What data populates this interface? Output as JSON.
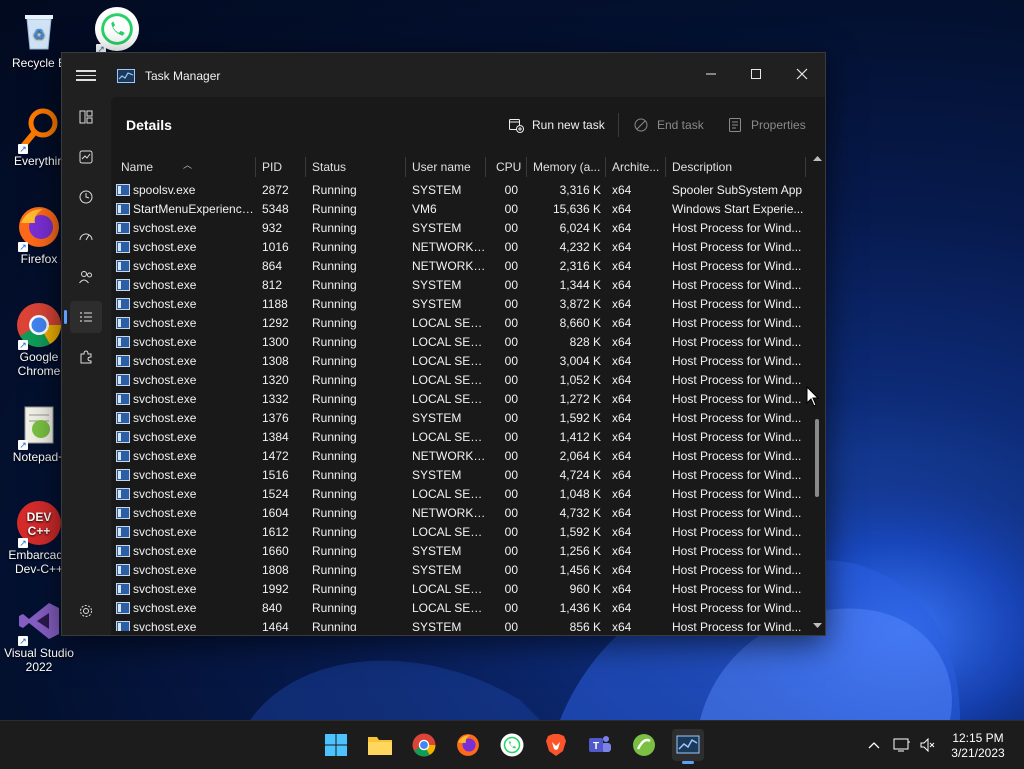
{
  "desktop": {
    "icons": [
      {
        "label": "Recycle B"
      },
      {
        "label": ""
      },
      {
        "label": "Everythin"
      },
      {
        "label": "Firefox"
      },
      {
        "label": "Google Chrome"
      },
      {
        "label": "Notepad+"
      },
      {
        "label": "Embarcade Dev-C++"
      },
      {
        "label": "Visual Studio 2022"
      }
    ]
  },
  "window": {
    "title": "Task Manager",
    "page_title": "Details",
    "toolbar": {
      "run_new_task": "Run new task",
      "end_task": "End task",
      "properties": "Properties"
    },
    "columns": [
      "Name",
      "PID",
      "Status",
      "User name",
      "CPU",
      "Memory (a...",
      "Archite...",
      "Description"
    ],
    "rows": [
      {
        "name": "spoolsv.exe",
        "pid": "2872",
        "status": "Running",
        "user": "SYSTEM",
        "cpu": "00",
        "memory": "3,316 K",
        "arch": "x64",
        "desc": "Spooler SubSystem App"
      },
      {
        "name": "StartMenuExperience...",
        "pid": "5348",
        "status": "Running",
        "user": "VM6",
        "cpu": "00",
        "memory": "15,636 K",
        "arch": "x64",
        "desc": "Windows Start Experie..."
      },
      {
        "name": "svchost.exe",
        "pid": "932",
        "status": "Running",
        "user": "SYSTEM",
        "cpu": "00",
        "memory": "6,024 K",
        "arch": "x64",
        "desc": "Host Process for Wind..."
      },
      {
        "name": "svchost.exe",
        "pid": "1016",
        "status": "Running",
        "user": "NETWORK ...",
        "cpu": "00",
        "memory": "4,232 K",
        "arch": "x64",
        "desc": "Host Process for Wind..."
      },
      {
        "name": "svchost.exe",
        "pid": "864",
        "status": "Running",
        "user": "NETWORK ...",
        "cpu": "00",
        "memory": "2,316 K",
        "arch": "x64",
        "desc": "Host Process for Wind..."
      },
      {
        "name": "svchost.exe",
        "pid": "812",
        "status": "Running",
        "user": "SYSTEM",
        "cpu": "00",
        "memory": "1,344 K",
        "arch": "x64",
        "desc": "Host Process for Wind..."
      },
      {
        "name": "svchost.exe",
        "pid": "1188",
        "status": "Running",
        "user": "SYSTEM",
        "cpu": "00",
        "memory": "3,872 K",
        "arch": "x64",
        "desc": "Host Process for Wind..."
      },
      {
        "name": "svchost.exe",
        "pid": "1292",
        "status": "Running",
        "user": "LOCAL SER...",
        "cpu": "00",
        "memory": "8,660 K",
        "arch": "x64",
        "desc": "Host Process for Wind..."
      },
      {
        "name": "svchost.exe",
        "pid": "1300",
        "status": "Running",
        "user": "LOCAL SER...",
        "cpu": "00",
        "memory": "828 K",
        "arch": "x64",
        "desc": "Host Process for Wind..."
      },
      {
        "name": "svchost.exe",
        "pid": "1308",
        "status": "Running",
        "user": "LOCAL SER...",
        "cpu": "00",
        "memory": "3,004 K",
        "arch": "x64",
        "desc": "Host Process for Wind..."
      },
      {
        "name": "svchost.exe",
        "pid": "1320",
        "status": "Running",
        "user": "LOCAL SER...",
        "cpu": "00",
        "memory": "1,052 K",
        "arch": "x64",
        "desc": "Host Process for Wind..."
      },
      {
        "name": "svchost.exe",
        "pid": "1332",
        "status": "Running",
        "user": "LOCAL SER...",
        "cpu": "00",
        "memory": "1,272 K",
        "arch": "x64",
        "desc": "Host Process for Wind..."
      },
      {
        "name": "svchost.exe",
        "pid": "1376",
        "status": "Running",
        "user": "SYSTEM",
        "cpu": "00",
        "memory": "1,592 K",
        "arch": "x64",
        "desc": "Host Process for Wind..."
      },
      {
        "name": "svchost.exe",
        "pid": "1384",
        "status": "Running",
        "user": "LOCAL SER...",
        "cpu": "00",
        "memory": "1,412 K",
        "arch": "x64",
        "desc": "Host Process for Wind..."
      },
      {
        "name": "svchost.exe",
        "pid": "1472",
        "status": "Running",
        "user": "NETWORK ...",
        "cpu": "00",
        "memory": "2,064 K",
        "arch": "x64",
        "desc": "Host Process for Wind..."
      },
      {
        "name": "svchost.exe",
        "pid": "1516",
        "status": "Running",
        "user": "SYSTEM",
        "cpu": "00",
        "memory": "4,724 K",
        "arch": "x64",
        "desc": "Host Process for Wind..."
      },
      {
        "name": "svchost.exe",
        "pid": "1524",
        "status": "Running",
        "user": "LOCAL SER...",
        "cpu": "00",
        "memory": "1,048 K",
        "arch": "x64",
        "desc": "Host Process for Wind..."
      },
      {
        "name": "svchost.exe",
        "pid": "1604",
        "status": "Running",
        "user": "NETWORK ...",
        "cpu": "00",
        "memory": "4,732 K",
        "arch": "x64",
        "desc": "Host Process for Wind..."
      },
      {
        "name": "svchost.exe",
        "pid": "1612",
        "status": "Running",
        "user": "LOCAL SER...",
        "cpu": "00",
        "memory": "1,592 K",
        "arch": "x64",
        "desc": "Host Process for Wind..."
      },
      {
        "name": "svchost.exe",
        "pid": "1660",
        "status": "Running",
        "user": "SYSTEM",
        "cpu": "00",
        "memory": "1,256 K",
        "arch": "x64",
        "desc": "Host Process for Wind..."
      },
      {
        "name": "svchost.exe",
        "pid": "1808",
        "status": "Running",
        "user": "SYSTEM",
        "cpu": "00",
        "memory": "1,456 K",
        "arch": "x64",
        "desc": "Host Process for Wind..."
      },
      {
        "name": "svchost.exe",
        "pid": "1992",
        "status": "Running",
        "user": "LOCAL SER...",
        "cpu": "00",
        "memory": "960 K",
        "arch": "x64",
        "desc": "Host Process for Wind..."
      },
      {
        "name": "svchost.exe",
        "pid": "840",
        "status": "Running",
        "user": "LOCAL SER...",
        "cpu": "00",
        "memory": "1,436 K",
        "arch": "x64",
        "desc": "Host Process for Wind..."
      },
      {
        "name": "svchost.exe",
        "pid": "1464",
        "status": "Running",
        "user": "SYSTEM",
        "cpu": "00",
        "memory": "856 K",
        "arch": "x64",
        "desc": "Host Process for Wind..."
      }
    ]
  },
  "taskbar": {
    "apps": [
      "start",
      "file-explorer",
      "chrome",
      "firefox",
      "whatsapp",
      "brave",
      "teams",
      "app-green",
      "task-manager"
    ],
    "clock_time": "12:15 PM",
    "clock_date": "3/21/2023"
  },
  "colors": {
    "accent": "#5ea0ff",
    "window_bg": "#202020",
    "content_bg": "#191919"
  }
}
